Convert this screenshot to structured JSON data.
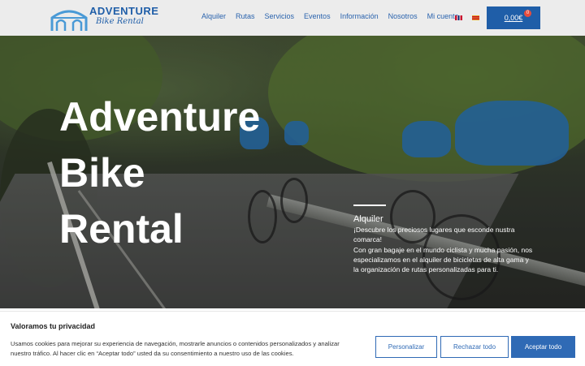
{
  "brand": {
    "title": "ADVENTURE",
    "subtitle": "Bike Rental"
  },
  "nav": {
    "items": [
      "Alquiler",
      "Rutas",
      "Servicios",
      "Eventos",
      "Información",
      "Nosotros",
      "Mi cuenta"
    ]
  },
  "languages": [
    "en-flag",
    "ca-flag"
  ],
  "cart": {
    "total": "0,00€",
    "count": "0"
  },
  "hero": {
    "title_lines": [
      "Adventure",
      "Bike",
      "Rental"
    ],
    "section_heading": "Alquiler",
    "paragraph1": "¡Descubre los preciosos lugares que esconde nustra comarca!",
    "paragraph2": "Con gran bagaje en el mundo ciclista y mucha pasión, nos especializamos en el alquiler de bicicletas de alta gama y la organización de rutas personalizadas para ti."
  },
  "cookie": {
    "title": "Valoramos tu privacidad",
    "text": "Usamos cookies para mejorar su experiencia de navegación, mostrarle anuncios o contenidos personalizados y analizar nuestro tráfico. Al hacer clic en “Aceptar todo” usted da su consentimiento a nuestro uso de las cookies.",
    "customize": "Personalizar",
    "reject": "Rechazar todo",
    "accept": "Aceptar todo"
  },
  "colors": {
    "brand_blue": "#1f5ea8",
    "button_blue": "#2f6ab5"
  }
}
